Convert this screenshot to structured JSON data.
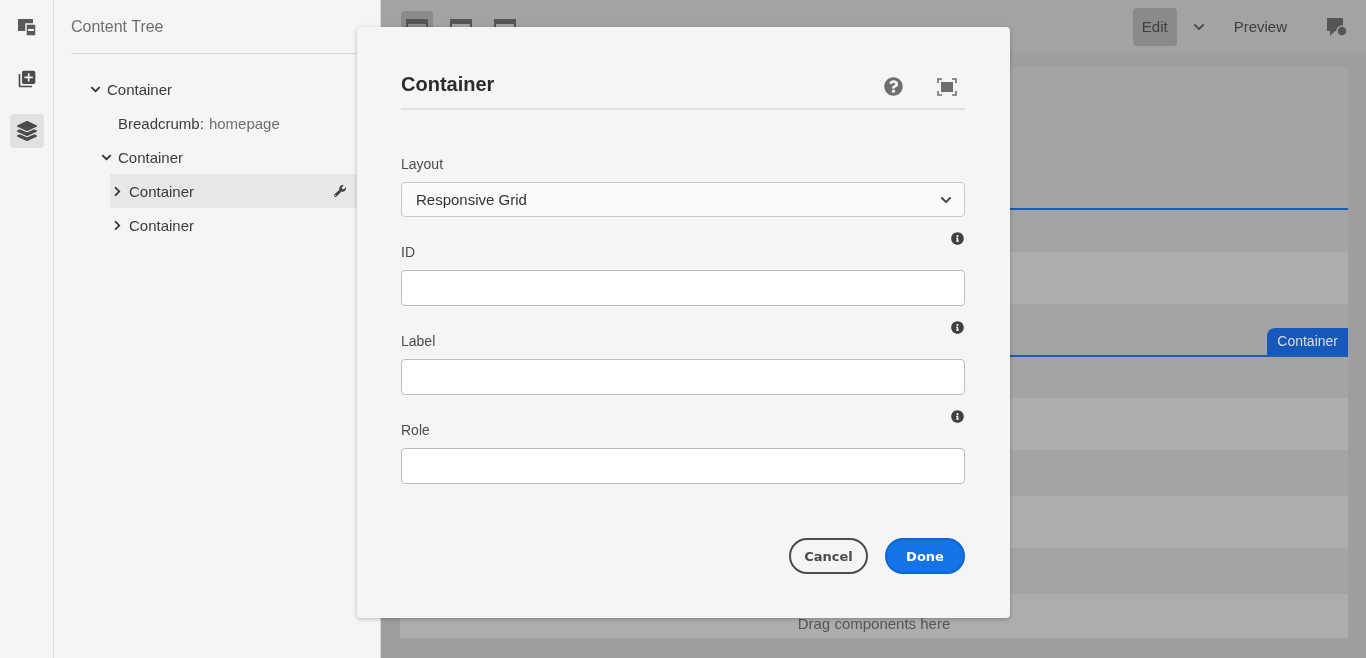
{
  "rail": [
    {
      "selected": false
    },
    {
      "selected": false
    },
    {
      "selected": true
    }
  ],
  "content_tree": {
    "title": "Content Tree",
    "items": [
      {
        "label": "Container",
        "expanded": true,
        "selected": false,
        "children": [
          {
            "label": "Breadcrumb:",
            "detail": "homepage",
            "selected": false
          },
          {
            "label": "Container",
            "expanded": true,
            "selected": false,
            "children": [
              {
                "label": "Container",
                "expanded": false,
                "selected": true
              },
              {
                "label": "Container",
                "expanded": false,
                "selected": false
              }
            ]
          }
        ]
      }
    ]
  },
  "toolbar": {
    "modes": [
      {
        "selected": true
      },
      {
        "selected": false
      },
      {
        "selected": false
      }
    ],
    "edit": {
      "label": "Edit",
      "selected": true
    },
    "preview": {
      "label": "Preview",
      "selected": false
    }
  },
  "canvas": {
    "badge": "Container",
    "placeholder": "Drag components here"
  },
  "dialog": {
    "title": "Container",
    "layout": {
      "label": "Layout",
      "value": "Responsive Grid"
    },
    "fields": [
      {
        "label": "ID"
      },
      {
        "label": "Label"
      },
      {
        "label": "Role"
      }
    ],
    "buttons": {
      "cancel": "Cancel",
      "done": "Done"
    }
  }
}
